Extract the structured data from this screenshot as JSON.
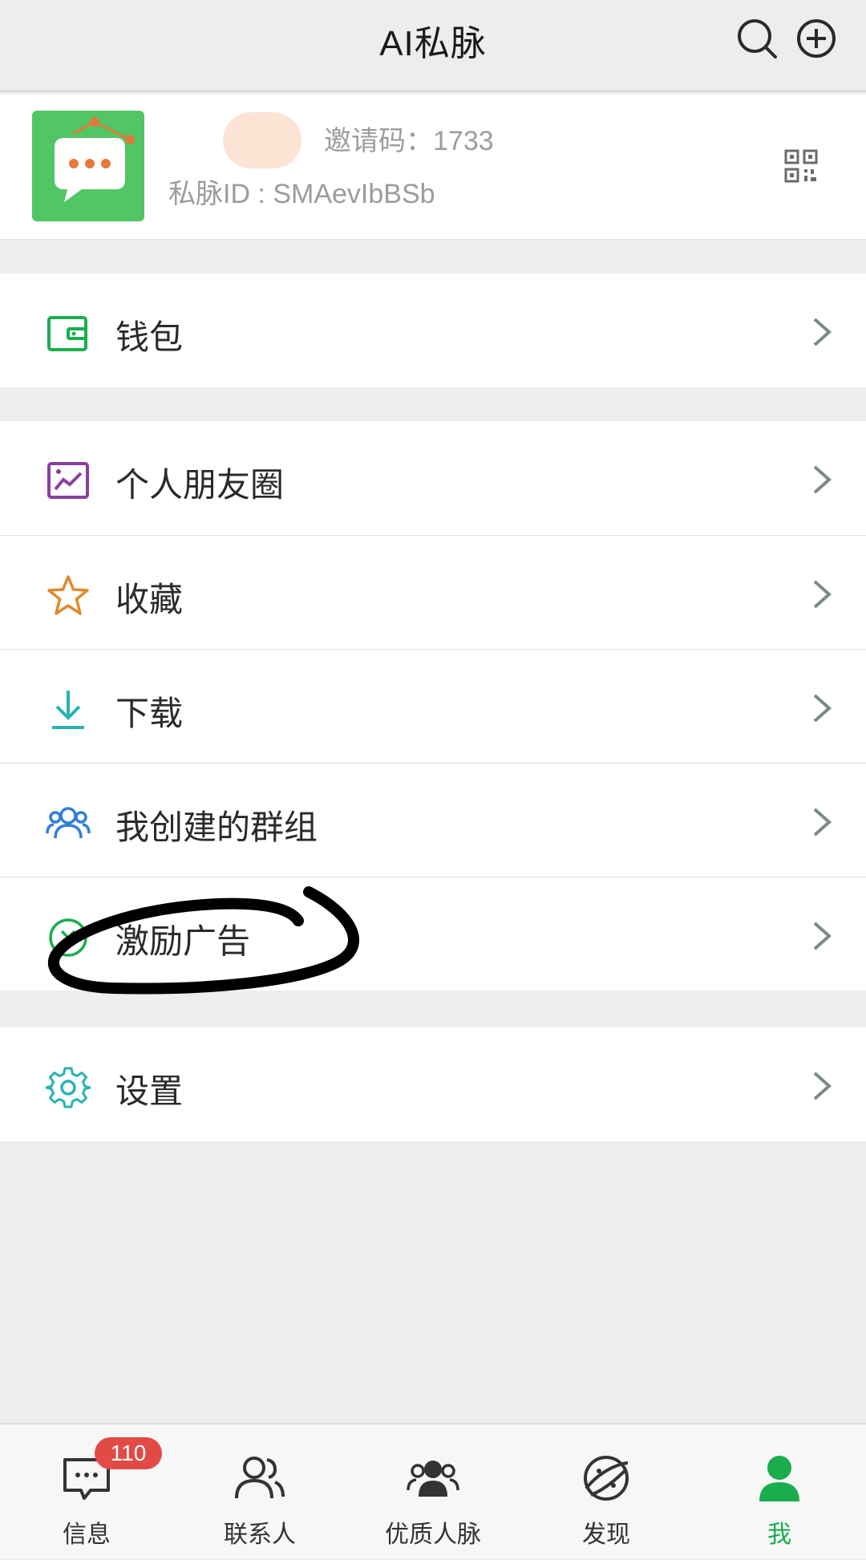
{
  "header": {
    "title": "AI私脉",
    "search_icon": "search-icon",
    "add_icon": "plus-circle-icon"
  },
  "profile": {
    "invite_code": "邀请码：1733",
    "private_id": "私脉ID : SMAevIbBSb",
    "qr_icon": "qr-code-icon"
  },
  "menu": {
    "wallet": "钱包",
    "moments": "个人朋友圈",
    "favorites": "收藏",
    "downloads": "下载",
    "my_groups": "我创建的群组",
    "reward_ads": "激励广告",
    "settings": "设置"
  },
  "tabbar": {
    "tabs": [
      {
        "label": "信息",
        "icon": "message-icon",
        "badge": "110"
      },
      {
        "label": "联系人",
        "icon": "contacts-icon"
      },
      {
        "label": "优质人脉",
        "icon": "premium-contacts-icon"
      },
      {
        "label": "发现",
        "icon": "discover-planet-icon"
      },
      {
        "label": "我",
        "icon": "me-icon",
        "active": true
      }
    ]
  },
  "colors": {
    "accent_green": "#1aad4e",
    "badge_red": "#e24a46",
    "annotation": "#000000"
  }
}
